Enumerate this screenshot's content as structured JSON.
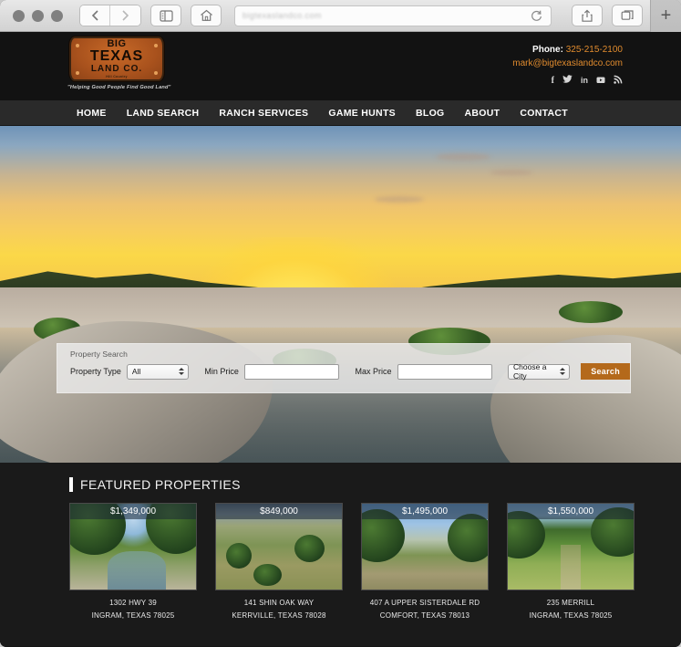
{
  "browser": {
    "url_placeholder": "bigtexaslandco.com",
    "buttons": {
      "back": "Back",
      "forward": "Forward",
      "sidebar": "Show Sidebar",
      "home": "Home",
      "reload": "Reload",
      "share": "Share",
      "tabs": "Show Tab Overview",
      "new_tab": "+"
    }
  },
  "site": {
    "logo": {
      "line1": "BIG",
      "line2": "TEXAS",
      "line3": "LAND CO.",
      "line4": "Hill Country",
      "tagline": "\"Helping Good People Find Good Land\""
    },
    "contact": {
      "phone_label": "Phone:",
      "phone_number": "325-215-2100",
      "email": "mark@bigtexaslandco.com",
      "socials": [
        {
          "name": "facebook-icon",
          "glyph": "f"
        },
        {
          "name": "twitter-icon",
          "glyph": "ᴠ"
        },
        {
          "name": "linkedin-icon",
          "glyph": "in"
        },
        {
          "name": "youtube-icon",
          "glyph": "▶"
        },
        {
          "name": "rss-icon",
          "glyph": "◜"
        }
      ]
    },
    "nav": [
      {
        "label": "HOME"
      },
      {
        "label": "LAND SEARCH"
      },
      {
        "label": "RANCH SERVICES"
      },
      {
        "label": "GAME HUNTS"
      },
      {
        "label": "BLOG"
      },
      {
        "label": "ABOUT"
      },
      {
        "label": "CONTACT"
      }
    ],
    "search_panel": {
      "title": "Property Search",
      "property_type_label": "Property Type",
      "property_type_value": "All",
      "min_price_label": "Min Price",
      "min_price_value": "",
      "min_price_placeholder": "",
      "max_price_label": "Max Price",
      "max_price_value": "",
      "max_price_placeholder": "",
      "city_value": "Choose a City",
      "search_button": "Search",
      "accent_color": "#b4691b"
    },
    "featured": {
      "title": "FEATURED PROPERTIES",
      "properties": [
        {
          "price": "$1,349,000",
          "address": "1302 HWY 39",
          "city": "INGRAM, TEXAS 78025"
        },
        {
          "price": "$849,000",
          "address": "141 SHIN OAK WAY",
          "city": "KERRVILLE, TEXAS 78028"
        },
        {
          "price": "$1,495,000",
          "address": "407 A UPPER SISTERDALE RD",
          "city": "COMFORT, TEXAS 78013"
        },
        {
          "price": "$1,550,000",
          "address": "235 MERRILL",
          "city": "INGRAM, TEXAS 78025"
        }
      ]
    }
  }
}
